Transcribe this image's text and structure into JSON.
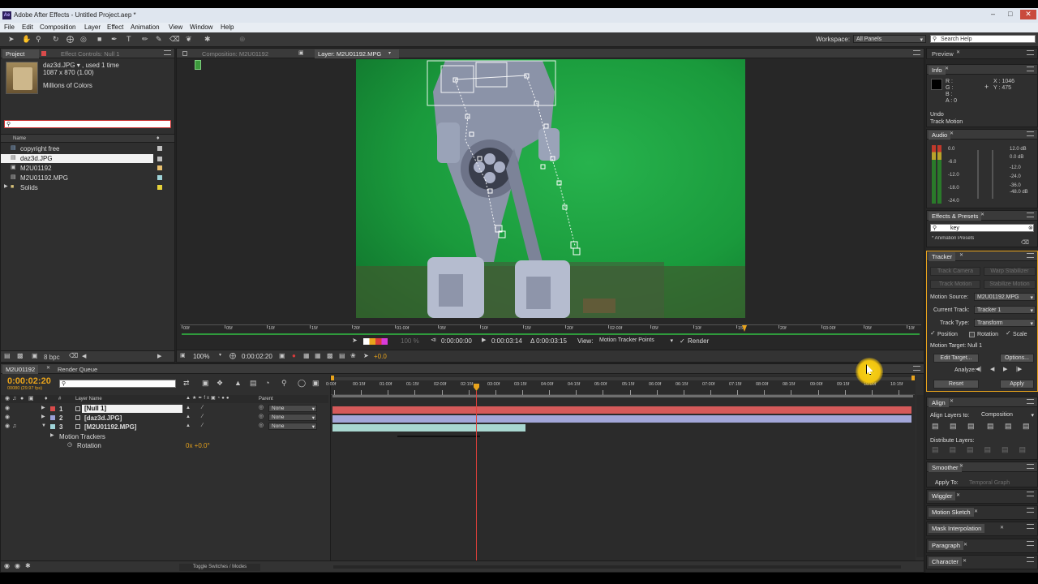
{
  "window": {
    "title": "Adobe After Effects - Untitled Project.aep *",
    "app_icon": "Ae"
  },
  "menu": [
    "File",
    "Edit",
    "Composition",
    "Layer",
    "Effect",
    "Animation",
    "View",
    "Window",
    "Help"
  ],
  "workspace": {
    "label": "Workspace:",
    "value": "All Panels"
  },
  "search_help": {
    "placeholder": "Search Help"
  },
  "project": {
    "tab": "Project",
    "effect_controls_tab": "Effect Controls: Null 1",
    "thumb_name": "daz3d.JPG ▾ , used 1 time",
    "thumb_dims": "1087 x 870 (1.00)",
    "thumb_colors": "Millions of Colors",
    "col_name": "Name",
    "items": [
      {
        "name": "copyright free",
        "color": "#c0c0c0",
        "selected": false
      },
      {
        "name": "daz3d.JPG",
        "color": "#c0c0c0",
        "selected": true
      },
      {
        "name": "M2U01192",
        "color": "#e8c070",
        "selected": false
      },
      {
        "name": "M2U01192.MPG",
        "color": "#9fd4d8",
        "selected": false
      },
      {
        "name": "Solids",
        "color": "#e6d23a",
        "selected": false
      }
    ],
    "bpc": "8 bpc"
  },
  "viewer": {
    "comp_tab": "Composition: M2U01192",
    "layer_tab": "Layer: M2U01192.MPG",
    "ruler_labels": [
      "00f",
      "05f",
      "10f",
      "15f",
      "20f",
      "01:00f",
      "05f",
      "10f",
      "15f",
      "20f",
      "02:00f",
      "05f",
      "10f",
      "15f",
      "20f",
      "03:00f",
      "05f",
      "10f"
    ],
    "in_time": "0:00:00:00",
    "out_time": "0:00:03:14",
    "duration": "Δ 0:00:03:15",
    "view_label": "View:",
    "view_value": "Motion Tracker Points",
    "render_label": "Render",
    "zoom": "100%",
    "time": "0:00:02:20",
    "exposure": "+0.0",
    "percent": "100 %"
  },
  "preview": {
    "tab": "Preview"
  },
  "info": {
    "tab": "Info",
    "r": "R :",
    "g": "G :",
    "b": "B :",
    "a": "A : 0",
    "x": "X : 1046",
    "y": "Y : 475",
    "undo": "Undo",
    "undo_action": "Track Motion"
  },
  "audio": {
    "tab": "Audio",
    "left_scale": [
      "0.0",
      "-6.0",
      "-12.0",
      "-18.0",
      "-24.0"
    ],
    "right_db": [
      "12.0 dB",
      "0.0 dB",
      "-12.0",
      "-24.0",
      "-36.0",
      "-48.0 dB"
    ]
  },
  "effects_presets": {
    "tab": "Effects & Presets",
    "search": "key",
    "category": "* Animation Presets"
  },
  "tracker": {
    "tab": "Tracker",
    "track_camera": "Track Camera",
    "warp_stabilizer": "Warp Stabilizer",
    "track_motion": "Track Motion",
    "stabilize_motion": "Stabilize Motion",
    "motion_source_label": "Motion Source:",
    "motion_source": "M2U01192.MPG",
    "current_track_label": "Current Track:",
    "current_track": "Tracker 1",
    "track_type_label": "Track Type:",
    "track_type": "Transform",
    "position": "Position",
    "rotation": "Rotation",
    "scale": "Scale",
    "motion_target": "Motion Target: Null 1",
    "edit_target": "Edit Target...",
    "options": "Options...",
    "analyze": "Analyze:",
    "reset": "Reset",
    "apply": "Apply"
  },
  "align": {
    "tab": "Align",
    "align_layers_to": "Align Layers to:",
    "align_value": "Composition",
    "distribute": "Distribute Layers:"
  },
  "smoother": {
    "tab": "Smoother",
    "apply_to": "Apply To:",
    "apply_value": "Temporal Graph"
  },
  "collapsed_panels": [
    "Wiggler",
    "Motion Sketch",
    "Mask Interpolation",
    "Paragraph",
    "Character"
  ],
  "timeline": {
    "tab": "M2U01192",
    "render_queue_tab": "Render Queue",
    "current_time": "0:00:02:20",
    "frame_info": "00080 (29.97 fps)",
    "col_layer_name": "Layer Name",
    "col_parent": "Parent",
    "col_num": "#",
    "layers": [
      {
        "num": "1",
        "name": "[Null 1]",
        "color": "#d94b4b",
        "parent": "None"
      },
      {
        "num": "2",
        "name": "[daz3d.JPG]",
        "color": "#9aa0d8",
        "parent": "None"
      },
      {
        "num": "3",
        "name": "[M2U01192.MPG]",
        "color": "#9fd4d8",
        "parent": "None"
      }
    ],
    "motion_trackers": "Motion Trackers",
    "rotation_label": "Rotation",
    "rotation_value": "0x +0.0°",
    "ruler": [
      "0:00f",
      "00:15f",
      "01:00f",
      "01:15f",
      "02:00f",
      "02:15f",
      "03:00f",
      "03:15f",
      "04:00f",
      "04:15f",
      "05:00f",
      "05:15f",
      "06:00f",
      "06:15f",
      "07:00f",
      "07:15f",
      "08:00f",
      "08:15f",
      "09:00f",
      "09:15f",
      "10:00f",
      "10:15f"
    ],
    "toggle": "Toggle Switches / Modes",
    "playhead_fraction": 0.249
  },
  "colors": {
    "accent": "#e8a31c",
    "playhead": "#e0403a",
    "green_screen": "#1f9a3c"
  }
}
